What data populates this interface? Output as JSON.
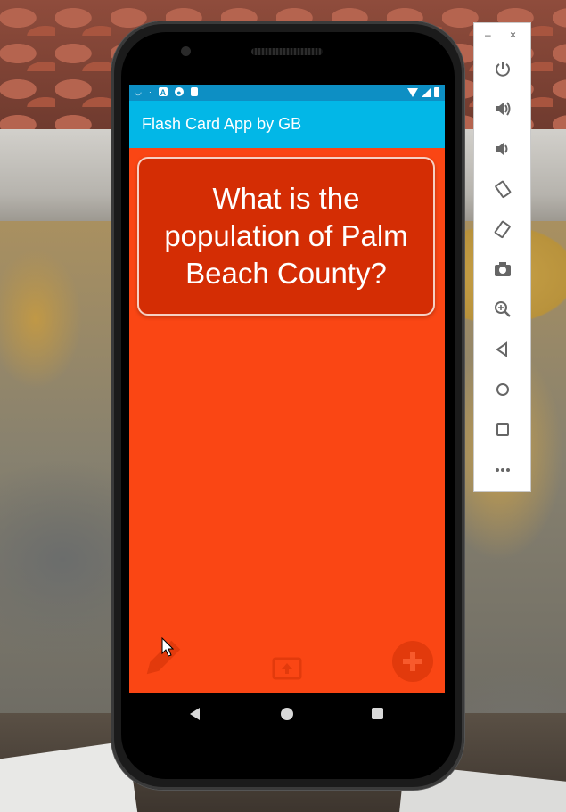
{
  "status_bar": {
    "left_icons": [
      "notification-icon",
      "notification-icon",
      "a-icon",
      "p-icon",
      "sd-icon"
    ],
    "a_label": "A",
    "right_icons": [
      "wifi-icon",
      "signal-icon",
      "battery-icon"
    ]
  },
  "app_bar": {
    "title": "Flash Card App by GB"
  },
  "card": {
    "question": "What is the population of Palm Beach County?"
  },
  "bottom_actions": {
    "edit_icon": "pencil-icon",
    "upload_icon": "upload-icon",
    "add_icon": "add-circle-icon"
  },
  "nav_bar": {
    "icons": [
      "back-icon",
      "home-icon",
      "recents-icon"
    ]
  },
  "emulator_panel": {
    "window_controls": {
      "minimize": "–",
      "close": "×"
    },
    "buttons": [
      "power-icon",
      "volume-up-icon",
      "volume-down-icon",
      "rotate-left-icon",
      "rotate-right-icon",
      "camera-icon",
      "zoom-icon",
      "back-icon",
      "home-icon",
      "overview-icon",
      "more-icon"
    ]
  },
  "colors": {
    "screen_bg": "#fa4614",
    "app_bar": "#02b7e7",
    "status_bar": "#0d8fc4",
    "card_bg": "#d42d04",
    "card_border": "#f6d1c4",
    "accent_button": "#e23a0c"
  }
}
